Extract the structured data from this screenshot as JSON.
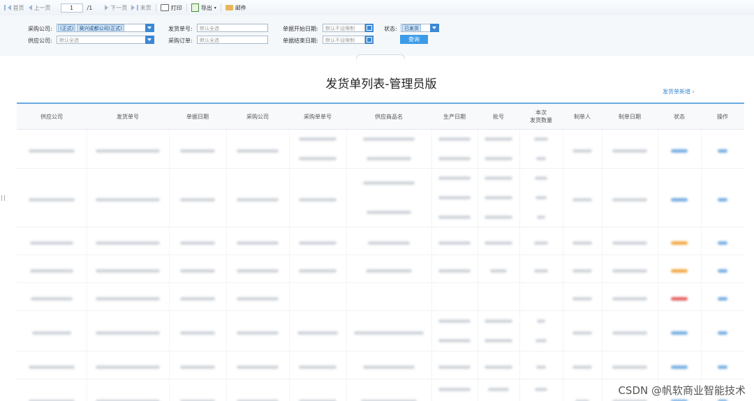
{
  "toolbar": {
    "first_label": "首页",
    "prev_label": "上一页",
    "page_value": "1",
    "page_total": "/1",
    "next_label": "下一页",
    "last_label": "末页",
    "print_label": "打印",
    "export_label": "导出",
    "mail_label": "邮件"
  },
  "filters": {
    "purchase_company_label": "采购公司:",
    "purchase_company_chip1": "(正式)",
    "purchase_company_chip2": "昊兴成都公司(正式)",
    "supplier_company_label": "供应公司:",
    "supplier_company_placeholder": "默认全选",
    "delivery_no_label": "发货单号:",
    "delivery_no_placeholder": "默认全选",
    "purchase_order_label": "采购订单:",
    "purchase_order_placeholder": "默认全选",
    "start_date_label": "单据开始日期:",
    "start_date_placeholder": "默认不设限制",
    "end_date_label": "单据结束日期:",
    "end_date_placeholder": "默认不设限制",
    "status_label": "状态:",
    "status_value": "已发货",
    "query_label": "查询"
  },
  "page": {
    "title": "发货单列表-管理员版",
    "new_link": "发货单新增 ›"
  },
  "table": {
    "headers": [
      "供应公司",
      "发货单号",
      "单据日期",
      "采购公司",
      "采购单单号",
      "供应商品名",
      "生产日期",
      "批号",
      "本次\n发货数量",
      "制单人",
      "制单日期",
      "状态",
      "操作"
    ]
  },
  "colors": {
    "accent": "#3b88d4",
    "status_blue": "#6aa6e0",
    "status_orange": "#f0a030",
    "status_red": "#e35050"
  },
  "watermark": "CSDN @帆软商业智能技术"
}
